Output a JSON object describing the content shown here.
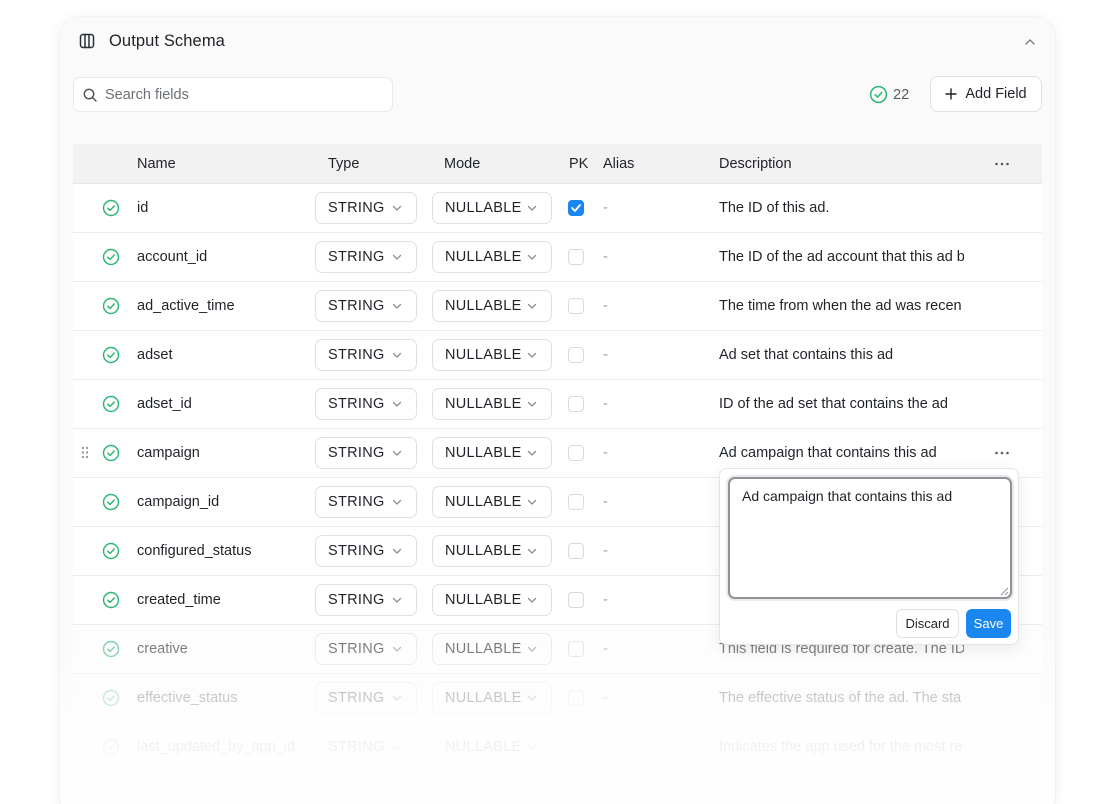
{
  "header": {
    "title": "Output Schema"
  },
  "search": {
    "placeholder": "Search fields"
  },
  "field_count": "22",
  "add_button": "Add Field",
  "columns": {
    "name": "Name",
    "type": "Type",
    "mode": "Mode",
    "pk": "PK",
    "alias": "Alias",
    "description": "Description"
  },
  "rows": [
    {
      "name": "id",
      "type": "STRING",
      "mode": "NULLABLE",
      "pk": true,
      "alias": "-",
      "description": "The ID of this ad."
    },
    {
      "name": "account_id",
      "type": "STRING",
      "mode": "NULLABLE",
      "pk": false,
      "alias": "-",
      "description": "The ID of the ad account that this ad b"
    },
    {
      "name": "ad_active_time",
      "type": "STRING",
      "mode": "NULLABLE",
      "pk": false,
      "alias": "-",
      "description": "The time from when the ad was recen"
    },
    {
      "name": "adset",
      "type": "STRING",
      "mode": "NULLABLE",
      "pk": false,
      "alias": "-",
      "description": "Ad set that contains this ad"
    },
    {
      "name": "adset_id",
      "type": "STRING",
      "mode": "NULLABLE",
      "pk": false,
      "alias": "-",
      "description": "ID of the ad set that contains the ad"
    },
    {
      "name": "campaign",
      "type": "STRING",
      "mode": "NULLABLE",
      "pk": false,
      "alias": "-",
      "description": "Ad campaign that contains this ad"
    },
    {
      "name": "campaign_id",
      "type": "STRING",
      "mode": "NULLABLE",
      "pk": false,
      "alias": "-",
      "description": ""
    },
    {
      "name": "configured_status",
      "type": "STRING",
      "mode": "NULLABLE",
      "pk": false,
      "alias": "-",
      "description": ""
    },
    {
      "name": "created_time",
      "type": "STRING",
      "mode": "NULLABLE",
      "pk": false,
      "alias": "-",
      "description": ""
    },
    {
      "name": "creative",
      "type": "STRING",
      "mode": "NULLABLE",
      "pk": false,
      "alias": "-",
      "description": "This field is required for create. The ID"
    },
    {
      "name": "effective_status",
      "type": "STRING",
      "mode": "NULLABLE",
      "pk": false,
      "alias": "-",
      "description": "The effective status of the ad. The sta"
    },
    {
      "name": "last_updated_by_app_id",
      "type": "STRING",
      "mode": "NULLABLE",
      "pk": false,
      "alias": "-",
      "description": "Indicates the app used for the most re"
    }
  ],
  "editor": {
    "value": "Ad campaign that contains this ad",
    "discard_label": "Discard",
    "save_label": "Save"
  },
  "colors": {
    "accent": "#1a86f0",
    "status_green": "#2bb673"
  },
  "icons": {
    "header": "columns-icon",
    "collapse": "chevron-up-icon",
    "search": "search-icon",
    "status": "check-circle-icon",
    "add": "plus-icon",
    "more": "more-horizontal-icon",
    "drag": "drag-handle-icon"
  }
}
